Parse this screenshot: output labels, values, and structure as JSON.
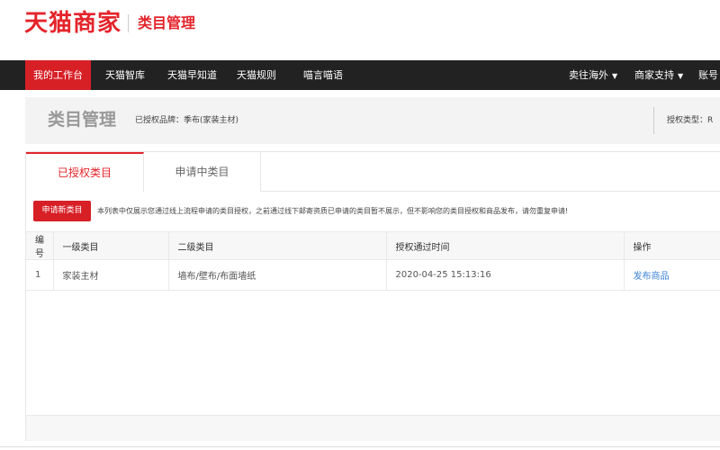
{
  "header": {
    "brand": "天猫商家",
    "section": "类目管理"
  },
  "nav": {
    "items": [
      {
        "label": "我的工作台",
        "active": true
      },
      {
        "label": "天猫智库"
      },
      {
        "label": "天猫早知道"
      },
      {
        "label": "天猫规则"
      },
      {
        "label": "喵言喵语"
      }
    ],
    "right_items": [
      {
        "label": "卖往海外",
        "arrow": "▼"
      },
      {
        "label": "商家支持",
        "arrow": "▼"
      },
      {
        "label": "账号"
      }
    ]
  },
  "page": {
    "title": "类目管理",
    "brand_auth": "已授权品牌：季布(家装主材)",
    "auth_type": "授权类型：R"
  },
  "tabs": [
    {
      "label": "已授权类目",
      "active": true
    },
    {
      "label": "申请中类目"
    }
  ],
  "toolbar": {
    "apply_label": "申请新类目",
    "notice": "本列表中仅展示您通过线上流程申请的类目授权，之前通过线下邮寄资质已申请的类目暂不展示，但不影响您的类目授权和商品发布，请勿重复申请!"
  },
  "table": {
    "columns": [
      "编号",
      "一级类目",
      "二级类目",
      "授权通过时间",
      "操作"
    ],
    "rows": [
      {
        "id": "1",
        "level1": "家装主材",
        "level2": "墙布/壁布/布面墙纸",
        "time": "2020-04-25 15:13:16",
        "action": "发布商品"
      }
    ]
  },
  "colors": {
    "brand_red": "#e4242b",
    "nav_bg": "#222222",
    "link_blue": "#3b82d6"
  }
}
